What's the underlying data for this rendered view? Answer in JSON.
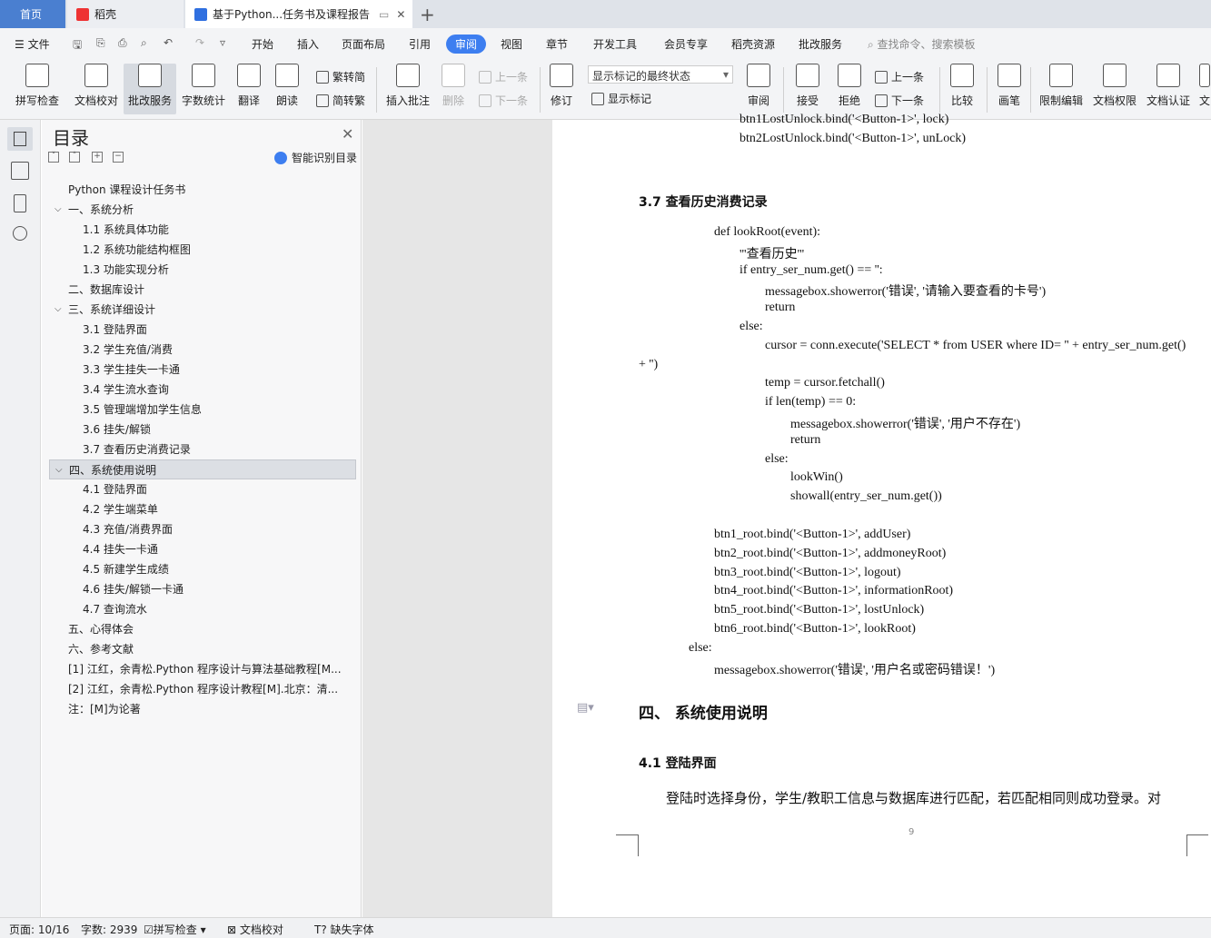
{
  "tabs": {
    "home": "首页",
    "daoke": "稻壳",
    "doc": "基于Python...任务书及课程报告",
    "new_tab": "+"
  },
  "menu": {
    "file": "文件",
    "items": [
      "开始",
      "插入",
      "页面布局",
      "引用",
      "审阅",
      "视图",
      "章节",
      "开发工具",
      "会员专享",
      "稻壳资源",
      "批改服务"
    ],
    "search": "查找命令、搜索模板"
  },
  "ribbon": {
    "spell_check": "拼写检查",
    "doc_check": "文档校对",
    "review_service": "批改服务",
    "word_count": "字数统计",
    "translate": "翻译",
    "read_aloud": "朗读",
    "to_traditional": "繁转简",
    "to_simplified": "简转繁",
    "insert_comment": "插入批注",
    "delete": "删除",
    "prev": "上一条",
    "next": "下一条",
    "track": "修订",
    "markup_state": "显示标记的最终状态",
    "show_markup": "显示标记",
    "review_pane": "审阅",
    "accept": "接受",
    "reject": "拒绝",
    "prev2": "上一条",
    "next2": "下一条",
    "compare": "比较",
    "pen": "画笔",
    "restrict_edit": "限制编辑",
    "doc_permission": "文档权限",
    "doc_cert": "文档认证",
    "more": "文"
  },
  "nav": {
    "title": "目录",
    "smart": "智能识别目录",
    "items": [
      {
        "text": "Python 课程设计任务书",
        "level": 0,
        "chev": false,
        "selected": false
      },
      {
        "text": "一、系统分析",
        "level": 0,
        "chev": true,
        "selected": false
      },
      {
        "text": "1.1  系统具体功能",
        "level": 1,
        "chev": false,
        "selected": false
      },
      {
        "text": "1.2  系统功能结构框图",
        "level": 1,
        "chev": false,
        "selected": false
      },
      {
        "text": "1.3  功能实现分析",
        "level": 1,
        "chev": false,
        "selected": false
      },
      {
        "text": "二、数据库设计",
        "level": 0,
        "chev": false,
        "selected": false
      },
      {
        "text": "三、系统详细设计",
        "level": 0,
        "chev": true,
        "selected": false
      },
      {
        "text": "3.1  登陆界面",
        "level": 1,
        "chev": false,
        "selected": false
      },
      {
        "text": "3.2  学生充值/消费",
        "level": 1,
        "chev": false,
        "selected": false
      },
      {
        "text": "3.3  学生挂失一卡通",
        "level": 1,
        "chev": false,
        "selected": false
      },
      {
        "text": "3.4  学生流水查询",
        "level": 1,
        "chev": false,
        "selected": false
      },
      {
        "text": "3.5  管理端增加学生信息",
        "level": 1,
        "chev": false,
        "selected": false
      },
      {
        "text": "3.6  挂失/解锁",
        "level": 1,
        "chev": false,
        "selected": false
      },
      {
        "text": "3.7  查看历史消费记录",
        "level": 1,
        "chev": false,
        "selected": false
      },
      {
        "text": "四、系统使用说明",
        "level": 0,
        "chev": true,
        "selected": true
      },
      {
        "text": "4.1  登陆界面",
        "level": 1,
        "chev": false,
        "selected": false
      },
      {
        "text": "4.2  学生端菜单",
        "level": 1,
        "chev": false,
        "selected": false
      },
      {
        "text": "4.3  充值/消费界面",
        "level": 1,
        "chev": false,
        "selected": false
      },
      {
        "text": "4.4 挂失一卡通",
        "level": 1,
        "chev": false,
        "selected": false
      },
      {
        "text": "4.5  新建学生成绩",
        "level": 1,
        "chev": false,
        "selected": false
      },
      {
        "text": "4.6  挂失/解锁一卡通",
        "level": 1,
        "chev": false,
        "selected": false
      },
      {
        "text": "4.7 查询流水",
        "level": 1,
        "chev": false,
        "selected": false
      },
      {
        "text": "五、心得体会",
        "level": 0,
        "chev": false,
        "selected": false
      },
      {
        "text": "六、参考文献",
        "level": 0,
        "chev": false,
        "selected": false
      },
      {
        "text": "[1]   江红，余青松.Python 程序设计与算法基础教程[M...",
        "level": 0,
        "chev": false,
        "selected": false
      },
      {
        "text": "[2]   江红，余青松.Python 程序设计教程[M].北京：清...",
        "level": 0,
        "chev": false,
        "selected": false
      },
      {
        "text": "注：[M]为论著",
        "level": 0,
        "chev": false,
        "selected": false
      }
    ]
  },
  "document": {
    "code_top": [
      "btn1LostUnlock.bind('<Button-1>', lock)",
      "btn2LostUnlock.bind('<Button-1>', unLock)"
    ],
    "heading_37": "3.7  查看历史消费记录",
    "code": [
      {
        "t": "def lookRoot(event):",
        "i": 0
      },
      {
        "t": "'''查看历史'''",
        "i": 1
      },
      {
        "t": "if entry_ser_num.get() == '':",
        "i": 1
      },
      {
        "t": "messagebox.showerror('错误', '请输入要查看的卡号')",
        "i": 2
      },
      {
        "t": "return",
        "i": 2
      },
      {
        "t": "else:",
        "i": 1
      },
      {
        "t": "cursor = conn.execute('SELECT * from USER where ID= '' + entry_ser_num.get()",
        "i": 2
      },
      {
        "t": "+ '')",
        "i": -3
      },
      {
        "t": "temp = cursor.fetchall()",
        "i": 2
      },
      {
        "t": "if len(temp) == 0:",
        "i": 2
      },
      {
        "t": "messagebox.showerror('错误', '用户不存在')",
        "i": 3
      },
      {
        "t": "return",
        "i": 3
      },
      {
        "t": "else:",
        "i": 2
      },
      {
        "t": "lookWin()",
        "i": 3
      },
      {
        "t": "showall(entry_ser_num.get())",
        "i": 3
      }
    ],
    "code_binds": [
      "btn1_root.bind('<Button-1>', addUser)",
      "btn2_root.bind('<Button-1>', addmoneyRoot)",
      "btn3_root.bind('<Button-1>', logout)",
      "btn4_root.bind('<Button-1>', informationRoot)",
      "btn5_root.bind('<Button-1>', lostUnlock)",
      "btn6_root.bind('<Button-1>', lookRoot)"
    ],
    "else_line": "else:",
    "error_line": "messagebox.showerror('错误', '用户名或密码错误！')",
    "heading_4": "四、     系统使用说明",
    "heading_41": "4.1  登陆界面",
    "paragraph": "登陆时选择身份，学生/教职工信息与数据库进行匹配，若匹配相同则成功登录。对",
    "page_number": "9"
  },
  "status": {
    "page": "页面: 10/16",
    "words": "字数: 2939",
    "spell": "拼写检查",
    "proof": "文档校对",
    "missing_font": "缺失字体"
  }
}
